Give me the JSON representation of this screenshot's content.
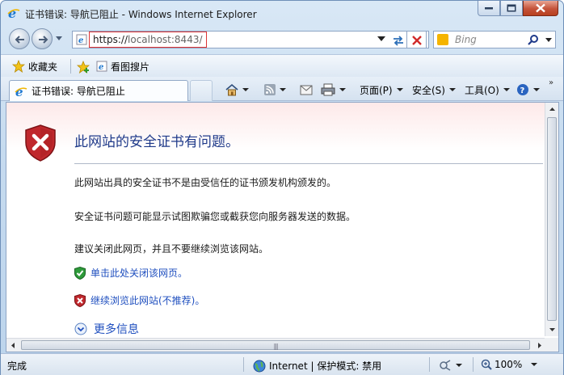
{
  "window": {
    "title": "证书错误: 导航已阻止 - Windows Internet Explorer"
  },
  "address_bar": {
    "url": "https://localhost:8443/",
    "url_prefix": "https://",
    "url_host": "localhost:8443/"
  },
  "search": {
    "placeholder": "Bing"
  },
  "favorites_bar": {
    "favorites_label": "收藏夹",
    "link_label": "看图搜片"
  },
  "tab": {
    "label": "证书错误: 导航已阻止"
  },
  "commands": {
    "page_label": "页面(P)",
    "safety_label": "安全(S)",
    "tools_label": "工具(O)"
  },
  "content": {
    "heading": "此网站的安全证书有问题。",
    "para1": "此网站出具的安全证书不是由受信任的证书颁发机构颁发的。",
    "para2": "安全证书问题可能显示试图欺骗您或截获您向服务器发送的数据。",
    "para3": "建议关闭此网页，并且不要继续浏览该网站。",
    "close_link": "单击此处关闭该网页。",
    "continue_link": "继续浏览此网站(不推荐)。",
    "more_info": "更多信息"
  },
  "status_bar": {
    "status_text": "完成",
    "zone_text": "Internet | 保护模式: 禁用",
    "zoom_text": "100%"
  },
  "colors": {
    "heading_blue": "#1f3a8a",
    "link_blue": "#1f4fbf",
    "shield_red": "#c0282d",
    "url_outline": "#dd3333"
  }
}
